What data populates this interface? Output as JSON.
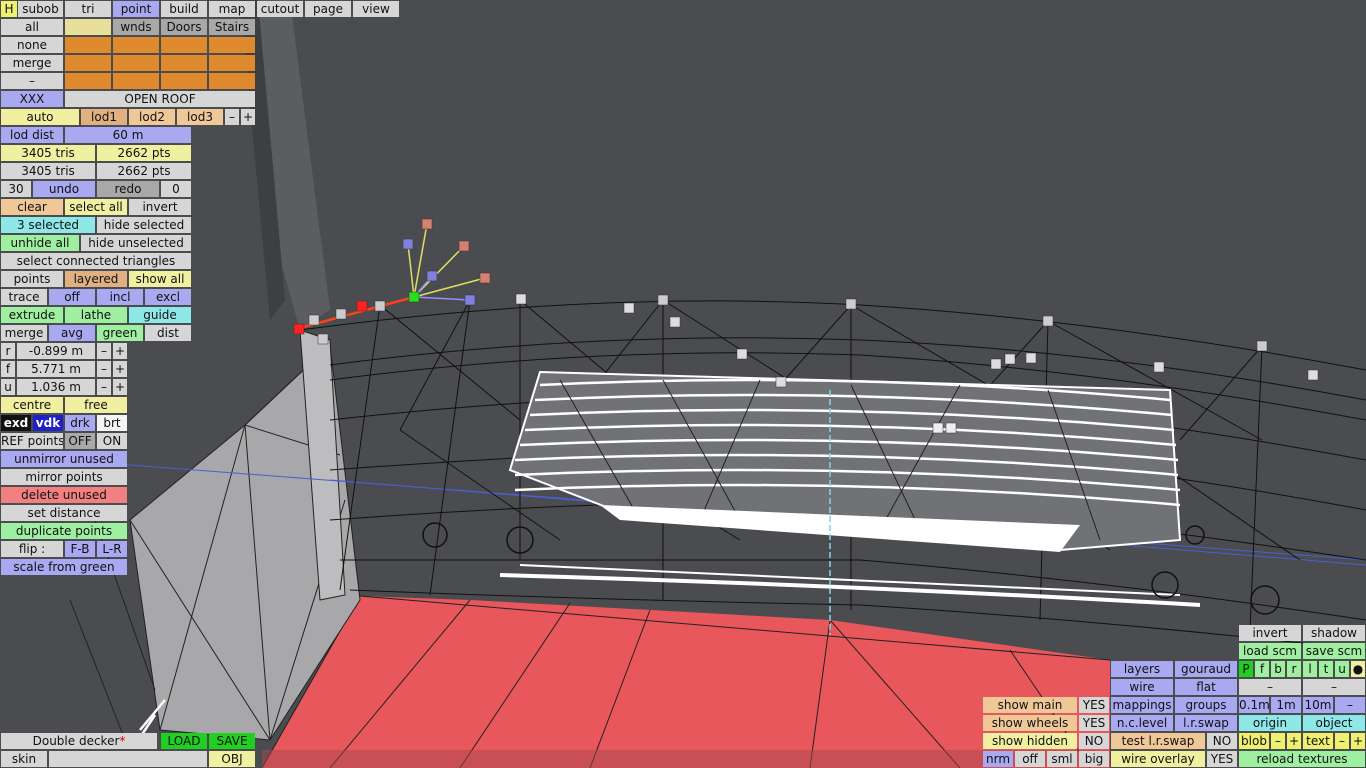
{
  "top_menu": {
    "h": "H",
    "subob": "subob",
    "tri": "tri",
    "point": "point",
    "build": "build",
    "map": "map",
    "cutout": "cutout",
    "page": "page",
    "view": "view"
  },
  "select_group": {
    "all": "all",
    "none": "none",
    "merge": "merge",
    "dash": "–",
    "wnds": "wnds",
    "doors": "Doors",
    "stairs": "Stairs"
  },
  "roof": {
    "xxx": "XXX",
    "open_roof": "OPEN ROOF"
  },
  "lod": {
    "auto": "auto",
    "lod1": "lod1",
    "lod2": "lod2",
    "lod3": "lod3",
    "minus": "–",
    "plus": "+",
    "dist_label": "lod dist",
    "dist_value": "60 m"
  },
  "stats": {
    "tris1": "3405 tris",
    "pts1": "2662 pts",
    "tris2": "3405 tris",
    "pts2": "2662 pts"
  },
  "history": {
    "count": "30",
    "undo": "undo",
    "redo": "redo",
    "redo_count": "0"
  },
  "selection": {
    "clear": "clear",
    "select_all": "select all",
    "invert": "invert",
    "selected": "3 selected",
    "hide_selected": "hide selected",
    "unhide_all": "unhide all",
    "hide_unselected": "hide unselected",
    "select_connected": "select connected triangles"
  },
  "points_row": {
    "points": "points",
    "layered": "layered",
    "show_all": "show all"
  },
  "trace_row": {
    "trace": "trace",
    "off": "off",
    "incl": "incl",
    "excl": "excl"
  },
  "extrude_row": {
    "extrude": "extrude",
    "lathe": "lathe",
    "guide": "guide"
  },
  "merge_row": {
    "merge": "merge",
    "avg": "avg",
    "green": "green",
    "dist": "dist"
  },
  "coords": {
    "r_label": "r",
    "r_value": "-0.899 m",
    "f_label": "f",
    "f_value": "5.771 m",
    "u_label": "u",
    "u_value": "1.036 m",
    "minus": "–",
    "plus": "+"
  },
  "pivot": {
    "centre": "centre",
    "free": "free"
  },
  "shade": {
    "exd": "exd",
    "vdk": "vdk",
    "drk": "drk",
    "brt": "brt"
  },
  "ref": {
    "label": "REF points",
    "off": "OFF",
    "on": "ON"
  },
  "actions": {
    "unmirror": "unmirror unused",
    "mirror": "mirror points",
    "delete_unused": "delete unused",
    "set_distance": "set distance",
    "duplicate": "duplicate points",
    "flip_label": "flip :",
    "flip_fb": "F-B",
    "flip_lr": "L-R",
    "scale_green": "scale from green"
  },
  "file": {
    "name": "Double decker",
    "modified": "*",
    "load": "LOAD",
    "save": "SAVE",
    "skin": "skin",
    "obj": "OBJ"
  },
  "right_panel": {
    "invert": "invert",
    "shadow": "shadow",
    "load_scm": "load scm",
    "save_scm": "save scm",
    "flags": [
      "P",
      "f",
      "b",
      "r",
      "l",
      "t",
      "u",
      "●"
    ],
    "layers": "layers",
    "gouraud": "gouraud",
    "wire": "wire",
    "flat": "flat",
    "dash": "–",
    "mappings": "mappings",
    "groups": "groups",
    "grid_01": "0.1m",
    "grid_1": "1m",
    "grid_10": "10m",
    "minus": "–",
    "nclevel": "n.c.level",
    "lrswap": "l.r.swap",
    "origin": "origin",
    "object": "object",
    "test_lr": "test l.r.swap",
    "no1": "NO",
    "blob": "blob",
    "text": "text",
    "plus": "+",
    "wire_overlay": "wire overlay",
    "yes": "YES",
    "reload": "reload textures",
    "show_main": "show main",
    "show_wheels": "show wheels",
    "show_hidden": "show hidden",
    "no2": "NO",
    "nrm": "nrm",
    "off": "off",
    "sml": "sml",
    "big": "big"
  }
}
